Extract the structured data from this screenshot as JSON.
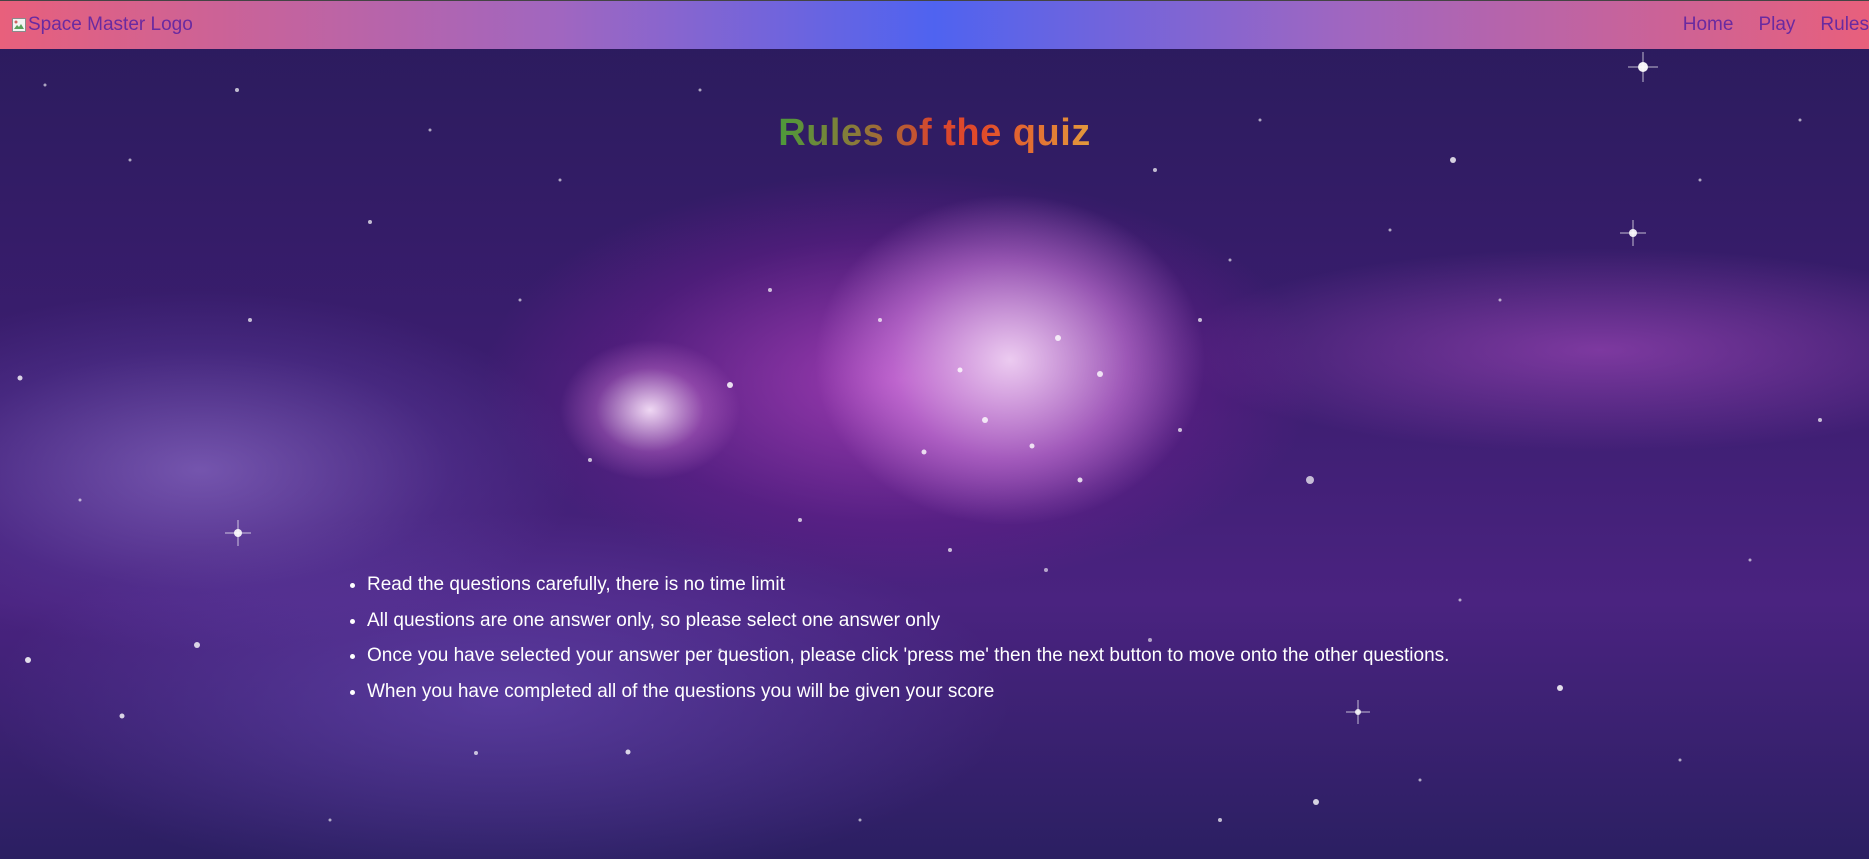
{
  "nav": {
    "logo_alt": "Space Master Logo",
    "links": [
      "Home",
      "Play",
      "Rules"
    ]
  },
  "page": {
    "title": "Rules of the quiz"
  },
  "rules": [
    "Read the questions carefully, there is no time limit",
    "All questions are one answer only, so please select one answer only",
    "Once you have selected your answer per question, please click 'press me' then the next button to move onto the other questions.",
    "When you have completed all of the questions you will be given your score"
  ],
  "colors": {
    "nav_text": "#6a2aa0",
    "nav_gradient": [
      "#e8607c",
      "#4f63f0",
      "#e8607c"
    ],
    "title_gradient": [
      "#4c9a3a",
      "#d8462e",
      "#e39a3c"
    ],
    "rules_text": "#ffffff"
  }
}
